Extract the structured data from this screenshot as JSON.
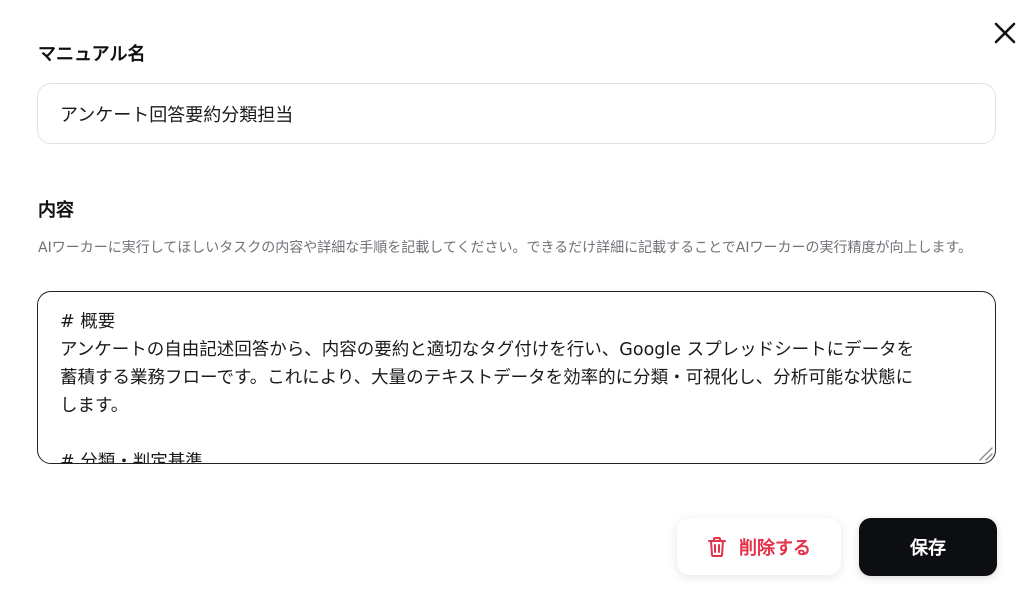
{
  "dialog": {
    "close_icon": "close-icon"
  },
  "manual_name": {
    "label": "マニュアル名",
    "value": "アンケート回答要約分類担当"
  },
  "content": {
    "label": "内容",
    "helper_text": "AIワーカーに実行してほしいタスクの内容や詳細な手順を記載してください。できるだけ詳細に記載することでAIワーカーの実行精度が向上します。",
    "lines": [
      "# 概要",
      "アンケートの自由記述回答から、内容の要約と適切なタグ付けを行い、Google スプレッドシートにデータを",
      "蓄積する業務フローです。これにより、大量のテキストデータを効率的に分類・可視化し、分析可能な状態に",
      "します。",
      "",
      "# 分類・判定基準"
    ]
  },
  "actions": {
    "delete_label": "削除する",
    "delete_icon": "trash-icon",
    "save_label": "保存"
  },
  "colors": {
    "danger": "#e5334b",
    "primary_button": "#0c0e12",
    "helper_text": "#6f7278"
  }
}
